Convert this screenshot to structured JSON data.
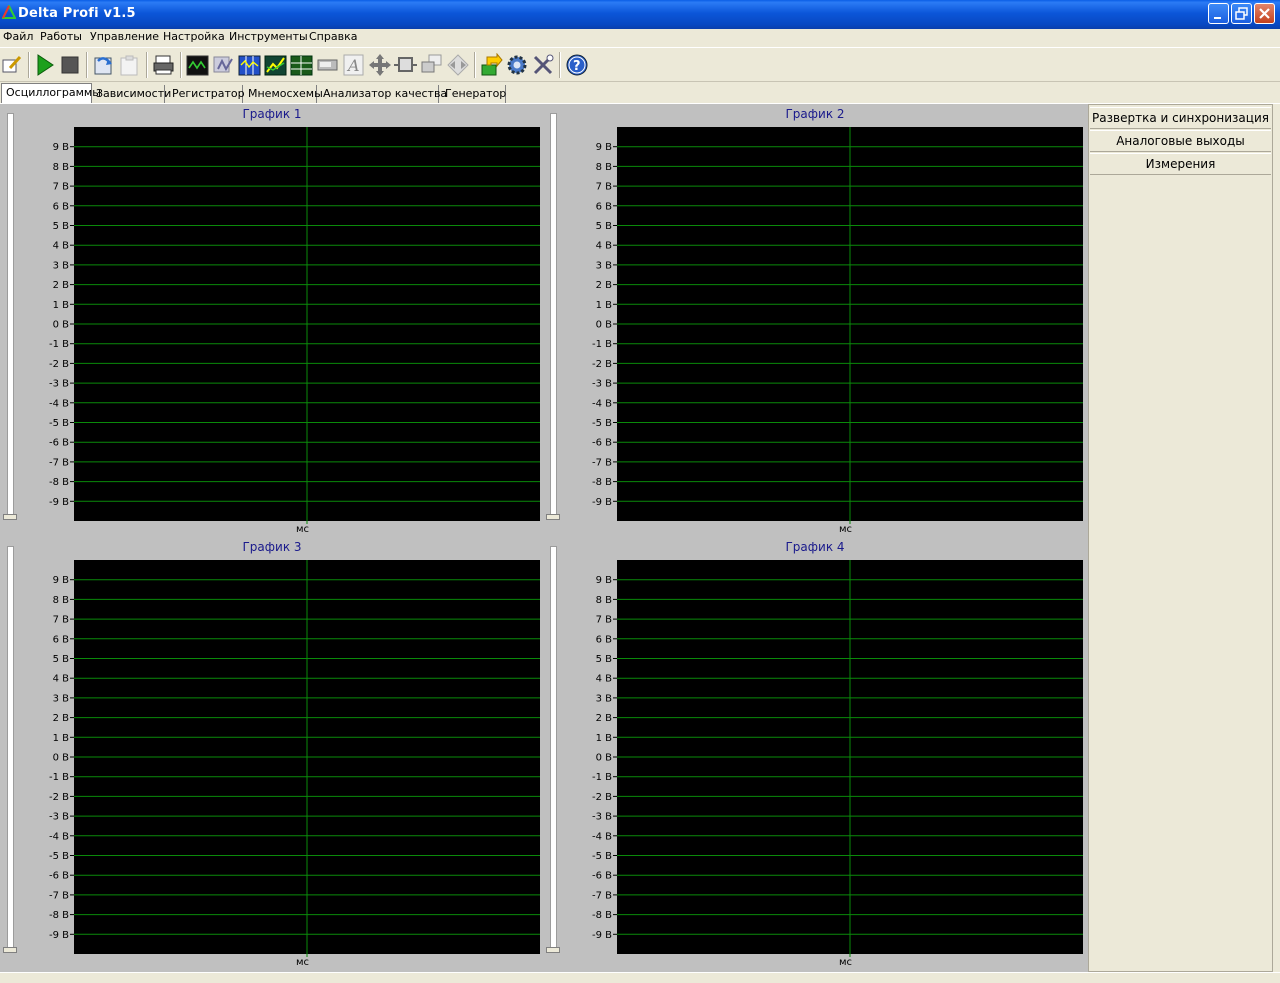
{
  "window": {
    "title": "Delta Profi v1.5",
    "icon": "delta-triangle-icon",
    "buttons": [
      "minimize-icon",
      "restore-icon",
      "close-icon"
    ]
  },
  "menu": {
    "items": [
      "Файл",
      "Работы",
      "Управление",
      "Настройка",
      "Инструменты",
      "Справка"
    ]
  },
  "toolbar": {
    "icons": [
      "edit-icon",
      "play-icon",
      "stop-icon",
      "import-icon",
      "paste-icon",
      "print-icon",
      "oscilloscope-icon",
      "waveform-icon",
      "channels-icon",
      "trend-icon",
      "table-icon",
      "device-icon",
      "text-icon",
      "move-icon",
      "single-window-icon",
      "multi-window-icon",
      "diamond-arrows-icon",
      "export-icon",
      "settings-gear-icon",
      "tools-icon",
      "help-icon"
    ]
  },
  "tabs": [
    "Осциллограммы",
    "Зависимости",
    "Регистратор",
    "Мнемосхемы",
    "Анализатор качества",
    "Генератор"
  ],
  "active_tab": "Осциллограммы",
  "right_panel": {
    "buttons": [
      "Развертка и синхронизация",
      "Аналоговые выходы",
      "Измерения"
    ]
  },
  "colors": {
    "plot_background": "#000000",
    "grid": "#0a8a0a",
    "title_text": "#1a1a8c",
    "panel": "#c0c0c0"
  },
  "chart_data": [
    {
      "type": "line",
      "title": "График 1",
      "xlabel": "мс",
      "ylabel": "",
      "ylim": [
        -10,
        10
      ],
      "y_ticks": [
        "9 В",
        "8 В",
        "7 В",
        "6 В",
        "5 В",
        "4 В",
        "3 В",
        "2 В",
        "1 В",
        "0 В",
        "-1 В",
        "-2 В",
        "-3 В",
        "-4 В",
        "-5 В",
        "-6 В",
        "-7 В",
        "-8 В",
        "-9 В"
      ],
      "series": [],
      "grid": true
    },
    {
      "type": "line",
      "title": "График 2",
      "xlabel": "мс",
      "ylabel": "",
      "ylim": [
        -10,
        10
      ],
      "y_ticks": [
        "9 В",
        "8 В",
        "7 В",
        "6 В",
        "5 В",
        "4 В",
        "3 В",
        "2 В",
        "1 В",
        "0 В",
        "-1 В",
        "-2 В",
        "-3 В",
        "-4 В",
        "-5 В",
        "-6 В",
        "-7 В",
        "-8 В",
        "-9 В"
      ],
      "series": [],
      "grid": true
    },
    {
      "type": "line",
      "title": "График 3",
      "xlabel": "мс",
      "ylabel": "",
      "ylim": [
        -10,
        10
      ],
      "y_ticks": [
        "9 В",
        "8 В",
        "7 В",
        "6 В",
        "5 В",
        "4 В",
        "3 В",
        "2 В",
        "1 В",
        "0 В",
        "-1 В",
        "-2 В",
        "-3 В",
        "-4 В",
        "-5 В",
        "-6 В",
        "-7 В",
        "-8 В",
        "-9 В"
      ],
      "series": [],
      "grid": true
    },
    {
      "type": "line",
      "title": "График 4",
      "xlabel": "мс",
      "ylabel": "",
      "ylim": [
        -10,
        10
      ],
      "y_ticks": [
        "9 В",
        "8 В",
        "7 В",
        "6 В",
        "5 В",
        "4 В",
        "3 В",
        "2 В",
        "1 В",
        "0 В",
        "-1 В",
        "-2 В",
        "-3 В",
        "-4 В",
        "-5 В",
        "-6 В",
        "-7 В",
        "-8 В",
        "-9 В"
      ],
      "series": [],
      "grid": true
    }
  ]
}
